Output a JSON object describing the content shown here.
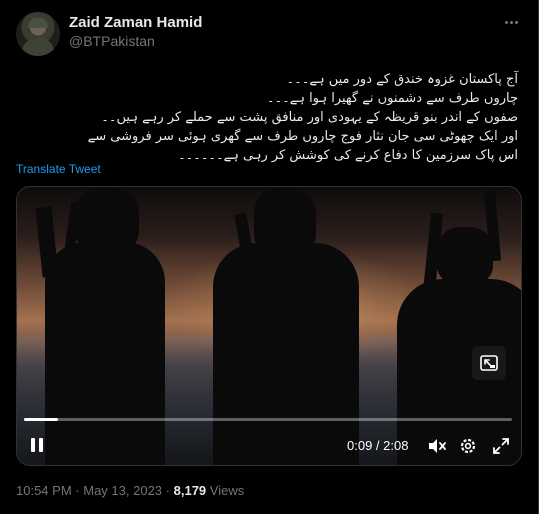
{
  "author": {
    "name": "Zaid Zaman Hamid",
    "handle": "@BTPakistan"
  },
  "tweet": {
    "lines": [
      "آج پاکستان غزوہ خندق کے دور میں ہے۔۔۔",
      "چاروں طرف سے دشمنوں نے گھیرا ہوا ہے۔۔۔",
      "صفوں کے اندر بنو قریظہ کے یہودی اور منافق پشت سے حملے کر رہے ہیں۔۔",
      "اور ایک چھوٹی سی جان نثار فوج چاروں طرف سے گھری ہوئی سر فروشی سے",
      "اس پاک سرزمین کا دفاع کرنے کی کوشش کر رہی ہے۔۔۔۔۔۔"
    ],
    "translate_label": "Translate Tweet"
  },
  "video": {
    "current_time": "0:09",
    "duration": "2:08",
    "time_display": "0:09 / 2:08",
    "progress": 0.07
  },
  "meta": {
    "time": "10:54 PM",
    "separator": "·",
    "date": "May 13, 2023",
    "views_count": "8,179",
    "views_label": "Views"
  },
  "icons": {
    "more": "more-horizontal-icon",
    "pip": "picture-in-picture-icon",
    "pause": "pause-icon",
    "mute": "mute-icon",
    "settings": "gear-icon",
    "fullscreen": "fullscreen-icon"
  },
  "colors": {
    "background": "#000000",
    "link": "#1d9bf0",
    "muted_text": "#71767b",
    "text": "#e7e9ea"
  }
}
